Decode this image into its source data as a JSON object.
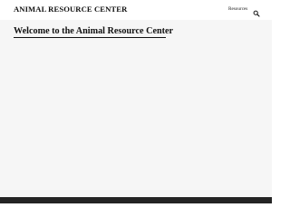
{
  "header": {
    "site_title": "ANIMAL RESOURCE CENTER",
    "nav": [
      {
        "label": "Resources"
      }
    ],
    "search_icon": "search-icon"
  },
  "main": {
    "page_title": "Welcome to the Animal Resource Center"
  },
  "colors": {
    "header_bg": "#ffffff",
    "page_bg": "#f6f6f6",
    "text": "#111111",
    "footer_bg": "#242424"
  }
}
